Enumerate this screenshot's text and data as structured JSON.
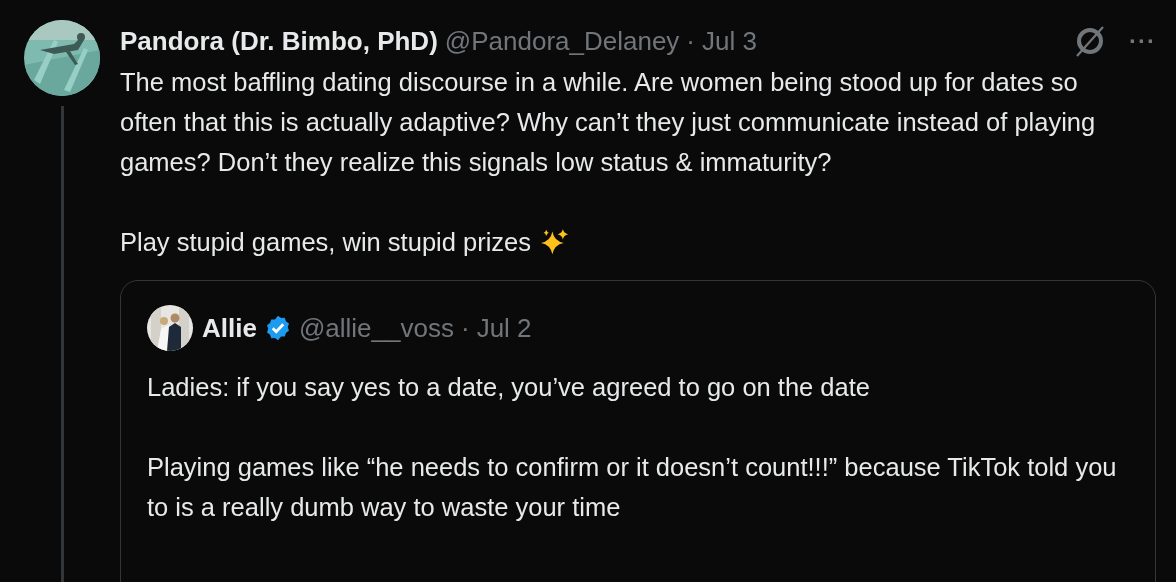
{
  "post": {
    "display_name": "Pandora (Dr. Bimbo, PhD)",
    "handle": "@Pandora_Delaney",
    "separator": "·",
    "date": "Jul 3",
    "more": "···",
    "paragraphs": [
      "The most baffling dating discourse in a while. Are women being stood up for dates so often that this is actually adaptive? Why can’t they just communicate instead of playing games? Don’t they realize this signals low status & immaturity?",
      "Play stupid games, win stupid prizes"
    ],
    "quote": {
      "display_name": "Allie",
      "verified": true,
      "handle": "@allie__voss",
      "separator": "·",
      "date": "Jul 2",
      "paragraphs": [
        "Ladies: if you say yes to a date, you’ve agreed to go on the date",
        "Playing games like “he needs to confirm or it doesn’t count!!!” because TikTok told you to is a really dumb way to waste your time"
      ]
    }
  }
}
